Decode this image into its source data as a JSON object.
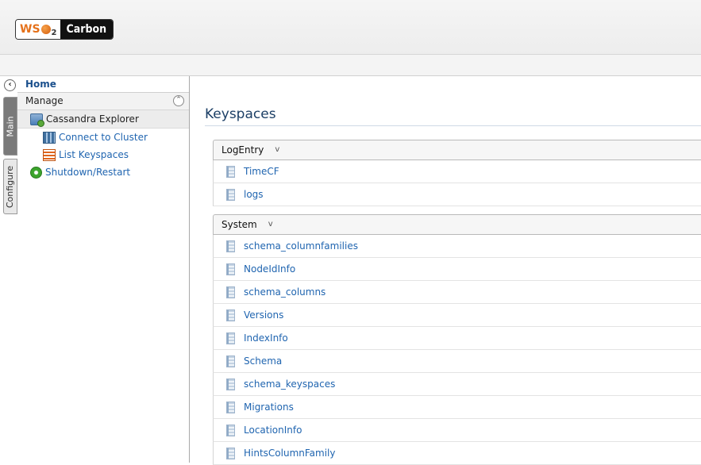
{
  "header": {
    "logo_brand": "WSO2",
    "logo_product": "Carbon"
  },
  "sidebar": {
    "collapse_symbol": "‹",
    "vertical_tabs": {
      "main": "Main",
      "configure": "Configure"
    },
    "home": "Home",
    "section": {
      "label": "Manage",
      "toggle_symbol": "⌃"
    },
    "items": [
      {
        "label": "Cassandra Explorer",
        "icon": "cassandra-explorer-icon"
      },
      {
        "label": "Connect to Cluster",
        "icon": "connect-cluster-icon"
      },
      {
        "label": "List Keyspaces",
        "icon": "list-keyspaces-icon"
      },
      {
        "label": "Shutdown/Restart",
        "icon": "shutdown-restart-icon"
      }
    ]
  },
  "main": {
    "title": "Keyspaces",
    "keyspaces": [
      {
        "name": "LogEntry",
        "column_families": [
          "TimeCF",
          "logs"
        ]
      },
      {
        "name": "System",
        "column_families": [
          "schema_columnfamilies",
          "NodeIdInfo",
          "schema_columns",
          "Versions",
          "IndexInfo",
          "Schema",
          "schema_keyspaces",
          "Migrations",
          "LocationInfo",
          "HintsColumnFamily"
        ]
      }
    ],
    "expand_symbol": "v"
  }
}
